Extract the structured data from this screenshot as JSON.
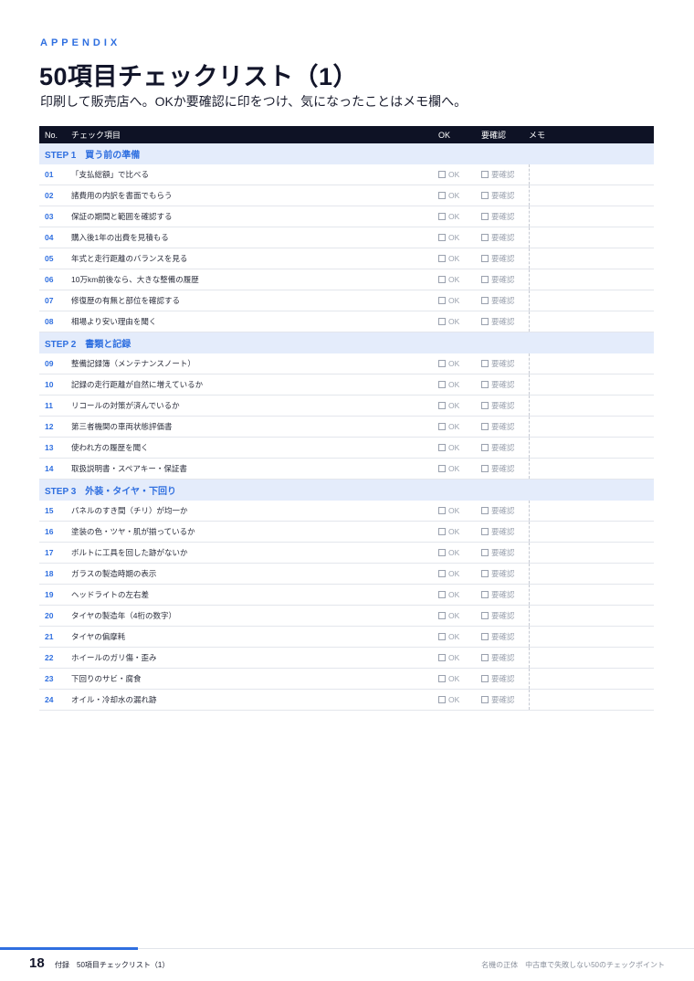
{
  "header": {
    "eyebrow": "APPENDIX",
    "title": "50項目チェックリスト（1）",
    "subtitle": "印刷して販売店へ。OKか要確認に印をつけ、気になったことはメモ欄へ。"
  },
  "table": {
    "columns": {
      "no": "No.",
      "item": "チェック項目",
      "ok": "OK",
      "req": "要確認",
      "memo": "メモ"
    },
    "ok_label": "OK",
    "req_label": "要確認",
    "steps": [
      {
        "title": "STEP 1　買う前の準備",
        "items": [
          {
            "no": "01",
            "label": "「支払総額」で比べる"
          },
          {
            "no": "02",
            "label": "諸費用の内訳を書面でもらう"
          },
          {
            "no": "03",
            "label": "保証の期間と範囲を確認する"
          },
          {
            "no": "04",
            "label": "購入後1年の出費を見積もる"
          },
          {
            "no": "05",
            "label": "年式と走行距離のバランスを見る"
          },
          {
            "no": "06",
            "label": "10万km前後なら、大きな整備の履歴"
          },
          {
            "no": "07",
            "label": "修復歴の有無と部位を確認する"
          },
          {
            "no": "08",
            "label": "相場より安い理由を聞く"
          }
        ]
      },
      {
        "title": "STEP 2　書類と記録",
        "items": [
          {
            "no": "09",
            "label": "整備記録簿（メンテナンスノート）"
          },
          {
            "no": "10",
            "label": "記録の走行距離が自然に増えているか"
          },
          {
            "no": "11",
            "label": "リコールの対策が済んでいるか"
          },
          {
            "no": "12",
            "label": "第三者機関の車両状態評価書"
          },
          {
            "no": "13",
            "label": "使われ方の履歴を聞く"
          },
          {
            "no": "14",
            "label": "取扱説明書・スペアキー・保証書"
          }
        ]
      },
      {
        "title": "STEP 3　外装・タイヤ・下回り",
        "items": [
          {
            "no": "15",
            "label": "パネルのすき間（チリ）が均一か"
          },
          {
            "no": "16",
            "label": "塗装の色・ツヤ・肌が揃っているか"
          },
          {
            "no": "17",
            "label": "ボルトに工具を回した跡がないか"
          },
          {
            "no": "18",
            "label": "ガラスの製造時期の表示"
          },
          {
            "no": "19",
            "label": "ヘッドライトの左右差"
          },
          {
            "no": "20",
            "label": "タイヤの製造年（4桁の数字）"
          },
          {
            "no": "21",
            "label": "タイヤの偏摩耗"
          },
          {
            "no": "22",
            "label": "ホイールのガリ傷・歪み"
          },
          {
            "no": "23",
            "label": "下回りのサビ・腐食"
          },
          {
            "no": "24",
            "label": "オイル・冷却水の漏れ跡"
          }
        ]
      }
    ]
  },
  "footer": {
    "page_number": "18",
    "left": "付録　50項目チェックリスト（1）",
    "right": "名機の正体　中古車で失敗しない50のチェックポイント"
  },
  "colors": {
    "accent": "#2f6fe0",
    "header_bg": "#0e1225",
    "step_bg": "#e4ecfb"
  }
}
